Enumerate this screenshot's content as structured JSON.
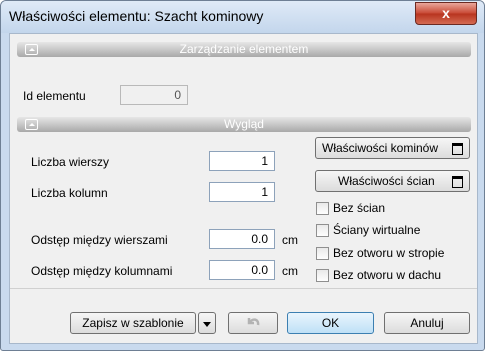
{
  "window": {
    "title": "Właściwości elementu: Szacht kominowy",
    "close_glyph": "x"
  },
  "sections": {
    "management": {
      "label": "Zarządzanie elementem",
      "id_label": "Id elementu",
      "id_value": "0"
    },
    "appearance": {
      "label": "Wygląd"
    }
  },
  "fields": {
    "rows": {
      "label": "Liczba wierszy",
      "value": "1"
    },
    "cols": {
      "label": "Liczba kolumn",
      "value": "1"
    },
    "row_gap": {
      "label": "Odstęp między wierszami",
      "value": "0.0",
      "unit": "cm"
    },
    "col_gap": {
      "label": "Odstęp między kolumnami",
      "value": "0.0",
      "unit": "cm"
    }
  },
  "buttons": {
    "chimney_props": "Właściwości kominów",
    "wall_props": "Właściwości ścian",
    "save_template": "Zapisz w szablonie",
    "ok": "OK",
    "cancel": "Anuluj"
  },
  "checkboxes": [
    {
      "label": "Bez ścian",
      "checked": false
    },
    {
      "label": "Ściany wirtualne",
      "checked": false
    },
    {
      "label": "Bez otworu w stropie",
      "checked": false
    },
    {
      "label": "Bez otworu w dachu",
      "checked": false
    }
  ],
  "icons": {
    "dropdown": "chevron-down-icon",
    "undo": "undo-icon",
    "expand": "window-icon",
    "collapse": "collapse-icon"
  }
}
